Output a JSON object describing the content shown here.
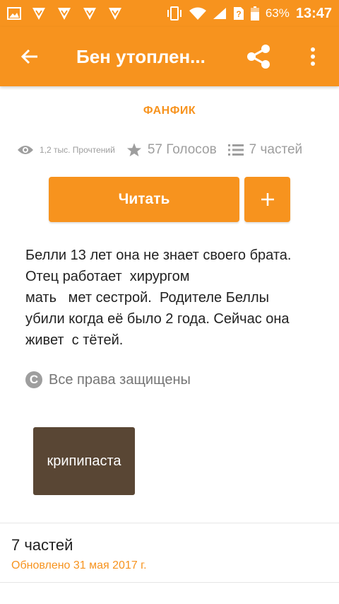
{
  "status_bar": {
    "battery_percent": "63%",
    "time": "13:47"
  },
  "app_bar": {
    "title": "Бен утоплен..."
  },
  "story": {
    "category": "ФАНФИК",
    "reads": "1,2 тыс. Прочтений",
    "votes": "57 Голосов",
    "parts": "7 частей",
    "read_button": "Читать",
    "add_button": "+",
    "description_lines": [
      "Белли 13 лет она не знает своего брата.",
      "Отец работает  хирургом",
      "мать   мет сестрой.  Родителе Беллы",
      "убили когда её было 2 года. Сейчас она",
      "живет  с тётей."
    ],
    "copyright": "Все права защищены",
    "tag": "крипипаста"
  },
  "parts_section": {
    "title": "7 частей",
    "updated": "Обновлено 31 мая 2017 г."
  },
  "colors": {
    "accent": "#f7931e",
    "tag_bg": "#594634"
  }
}
